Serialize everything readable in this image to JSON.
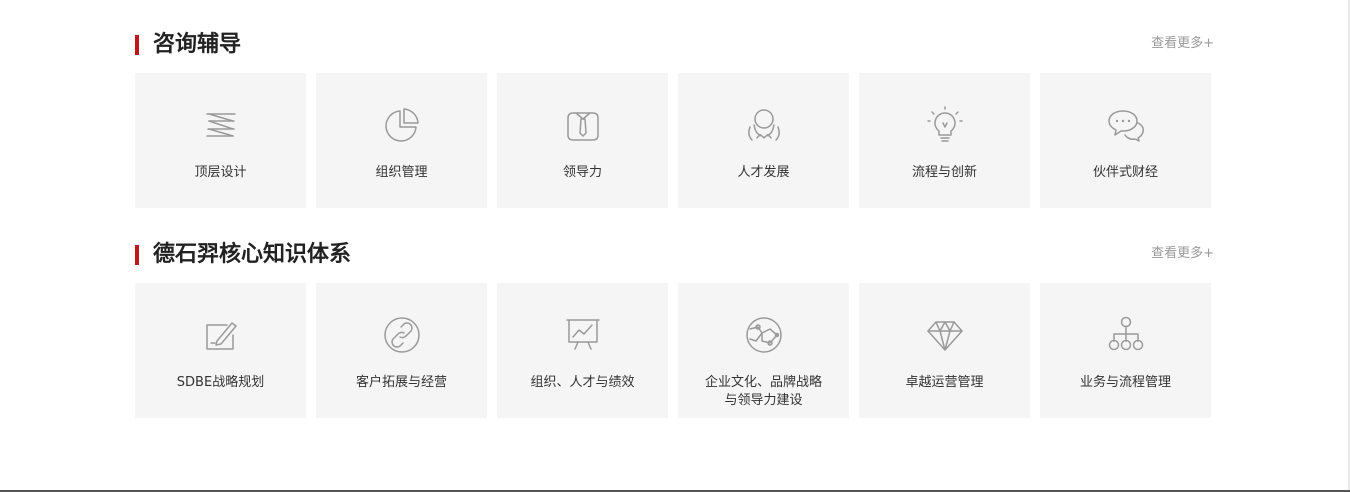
{
  "sections": [
    {
      "title": "咨询辅导",
      "more": "查看更多+",
      "cards": [
        {
          "label": "顶层设计",
          "icon": "layers-icon"
        },
        {
          "label": "组织管理",
          "icon": "pie-chart-icon"
        },
        {
          "label": "领导力",
          "icon": "tie-icon"
        },
        {
          "label": "人才发展",
          "icon": "team-hands-icon"
        },
        {
          "label": "流程与创新",
          "icon": "lightbulb-icon"
        },
        {
          "label": "伙伴式财经",
          "icon": "chat-bubbles-icon"
        }
      ]
    },
    {
      "title": "德石羿核心知识体系",
      "more": "查看更多+",
      "cards": [
        {
          "label": "SDBE战略规划",
          "icon": "edit-pen-icon"
        },
        {
          "label": "客户拓展与经营",
          "icon": "link-icon"
        },
        {
          "label": "组织、人才与绩效",
          "icon": "presentation-board-icon"
        },
        {
          "label": "企业文化、品牌战略与领导力建设",
          "line1": "企业文化、品牌战略",
          "line2": "与领导力建设",
          "icon": "globe-network-icon"
        },
        {
          "label": "卓越运营管理",
          "icon": "diamond-icon"
        },
        {
          "label": "业务与流程管理",
          "icon": "hierarchy-icon"
        }
      ]
    }
  ]
}
